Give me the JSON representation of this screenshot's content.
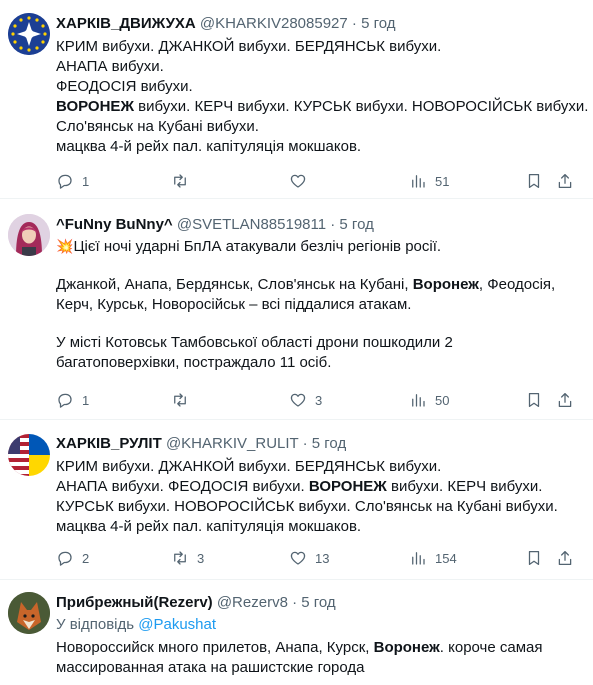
{
  "tweets": [
    {
      "name": "ХАРКІВ_ДВИЖУХА",
      "handle": "@KHARKIV28085927",
      "sep": "·",
      "time": "5 год",
      "lines": [
        "КРИМ вибухи. ДЖАНКОЙ вибухи. БЕРДЯНСЬК вибухи.",
        "АНАПА вибухи.",
        "ФЕОДОСІЯ вибухи.",
        {
          "bold": "ВОРОНЕЖ",
          "rest": " вибухи. КЕРЧ вибухи.  КУРСЬК вибухи. НОВОРОСІЙСЬК вибухи."
        },
        " Сло'вянськ на Кубані вибухи.",
        "мацква 4-й рейх пал. капітуляція мокшаков."
      ],
      "replies": "1",
      "retweets": "",
      "likes": "",
      "views": "51"
    },
    {
      "name": "^FuNny BuNny^",
      "handle": "@SVETLAN88519811",
      "sep": "·",
      "time": "5 год",
      "lines": [
        "Цієї ночі ударні БпЛА атакували безліч регіонів росії.",
        "",
        {
          "pre": "Джанкой, Анапа, Бердянськ, Слов'янськ на Кубані, ",
          "bold": "Воронеж",
          "rest": ", Феодосія,"
        },
        "Керч, Курськ, Новоросійськ – всі піддалися атакам.",
        "",
        "У місті Котовськ Тамбовської області дрони пошкодили 2",
        "багатоповерхівки, постраждало 11 осіб."
      ],
      "replies": "1",
      "retweets": "",
      "likes": "3",
      "views": "50"
    },
    {
      "name": "ХАРКІВ_РУЛІТ",
      "handle": "@KHARKIV_RULIT",
      "sep": "·",
      "time": "5 год",
      "lines": [
        "КРИМ вибухи. ДЖАНКОЙ вибухи. БЕРДЯНСЬК вибухи.",
        {
          "pre": "АНАПА вибухи. ФЕОДОСІЯ вибухи. ",
          "bold": "ВОРОНЕЖ",
          "rest": " вибухи. КЕРЧ вибухи."
        },
        "КУРСЬК вибухи. НОВОРОСІЙСЬК вибухи. Сло'вянськ на Кубані вибухи.",
        "мацква 4-й рейх пал. капітуляція мокшаков."
      ],
      "replies": "2",
      "retweets": "3",
      "likes": "13",
      "views": "154"
    },
    {
      "name": "Прибрежный(Rezerv)",
      "handle": "@Rezerv8",
      "sep": "·",
      "time": "5 год",
      "reply_to_prefix": "У відповідь ",
      "reply_to_handle": "@Pakushat",
      "lines": [
        {
          "pre": "Новороссийск много прилетов, Анапа, Курск, ",
          "bold": "Воронеж",
          "rest": ". короче самая"
        },
        "массированная атака на рашистские города"
      ]
    }
  ],
  "icons": {
    "reply": "reply-icon",
    "retweet": "retweet-icon",
    "like": "heart-icon",
    "views": "views-icon",
    "bookmark": "bookmark-icon",
    "share": "share-icon",
    "collision": "💥"
  }
}
